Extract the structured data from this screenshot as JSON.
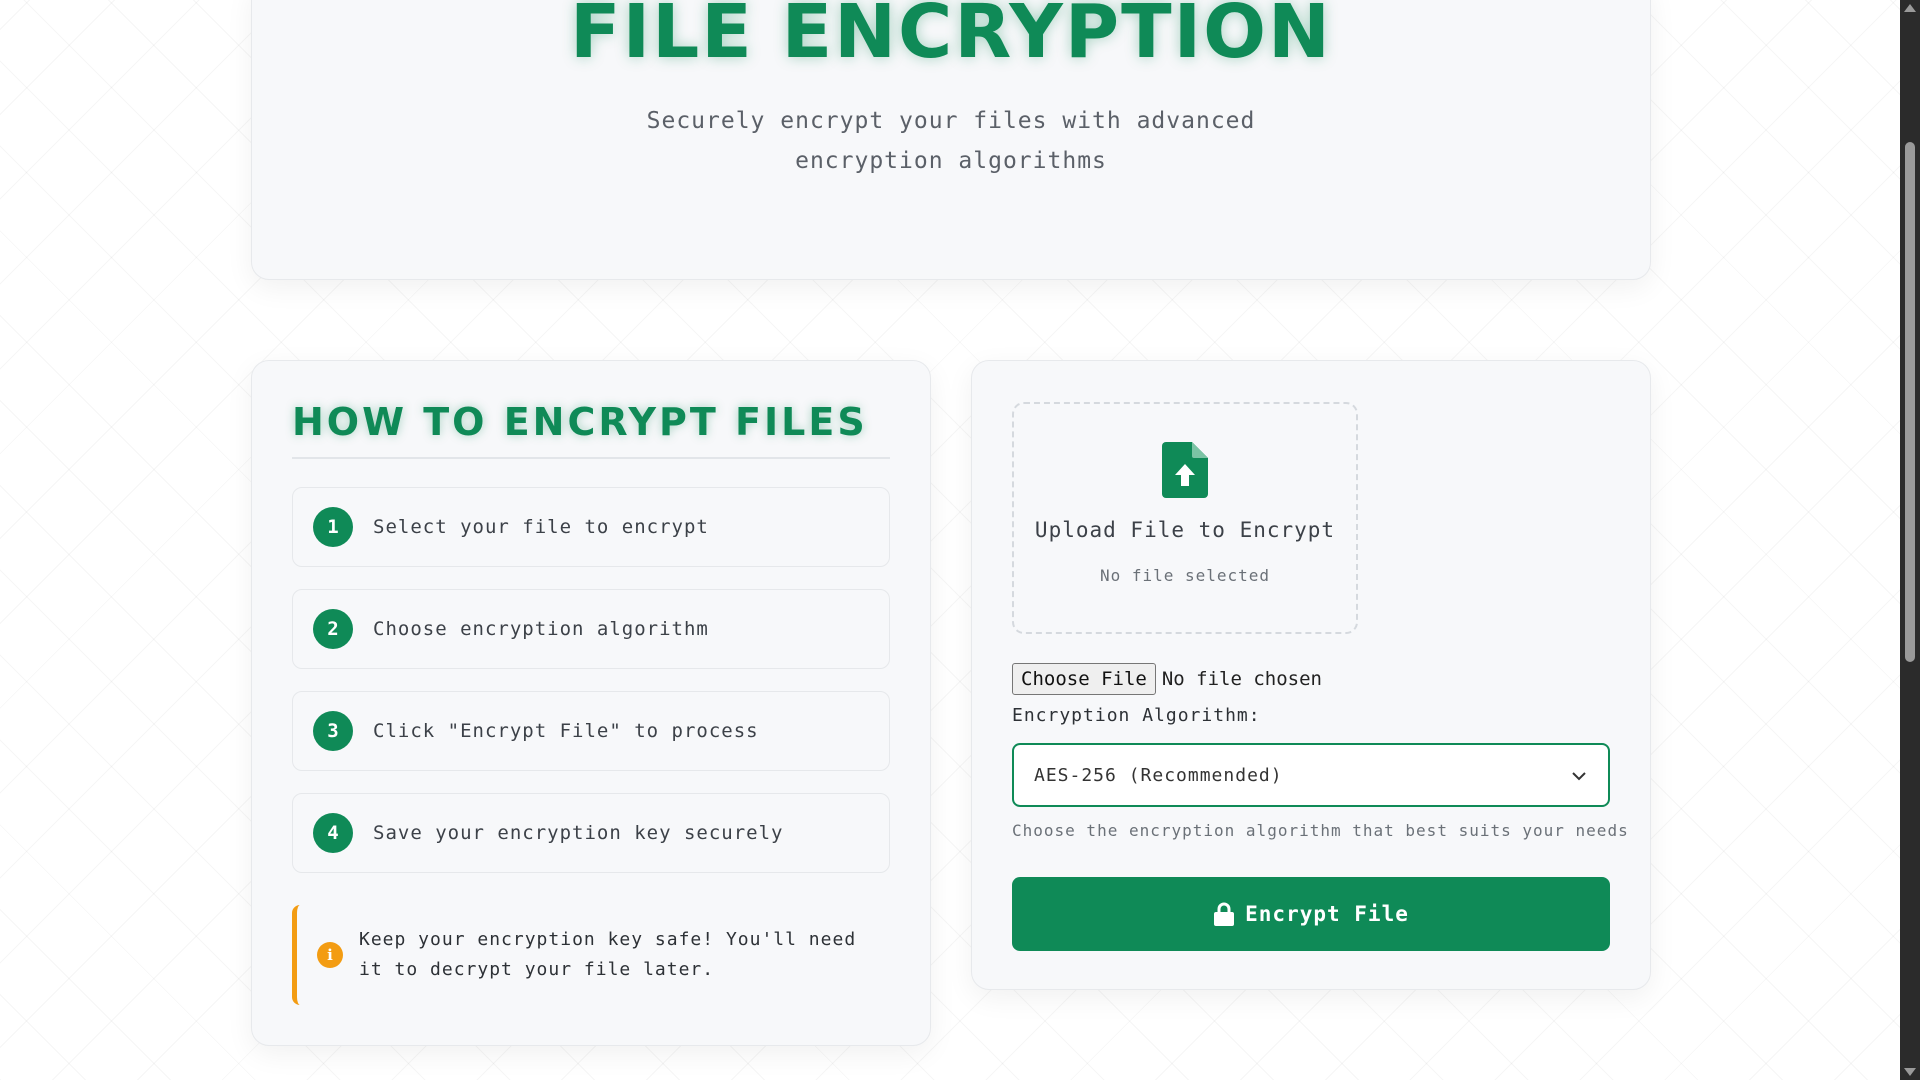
{
  "hero": {
    "title": "FILE ENCRYPTION",
    "subtitle": "Securely encrypt your files with advanced encryption algorithms"
  },
  "steps": {
    "title": "HOW TO ENCRYPT FILES",
    "items": [
      {
        "number": "1",
        "text": "Select your file to encrypt"
      },
      {
        "number": "2",
        "text": "Choose encryption algorithm"
      },
      {
        "number": "3",
        "text": "Click \"Encrypt File\" to process"
      },
      {
        "number": "4",
        "text": "Save your encryption key securely"
      }
    ],
    "note": {
      "icon": "info-icon",
      "text": "Keep your encryption key safe! You'll need it to decrypt your file later."
    }
  },
  "upload": {
    "dropzone_icon": "file-upload-icon",
    "dropzone_title": "Upload File to Encrypt",
    "dropzone_status": "No file selected",
    "choose_button_label": "Choose File",
    "file_status": "No file chosen",
    "algorithm_label": "Encryption Algorithm:",
    "algorithm_selected": "AES-256 (Recommended)",
    "algorithm_hint": "Choose the encryption algorithm that best suits your needs",
    "encrypt_button_label": "Encrypt File",
    "encrypt_button_icon": "lock-icon"
  },
  "colors": {
    "accent": "#0f8a57",
    "warning": "#f39c12",
    "card_background": "#f7f8fa"
  }
}
